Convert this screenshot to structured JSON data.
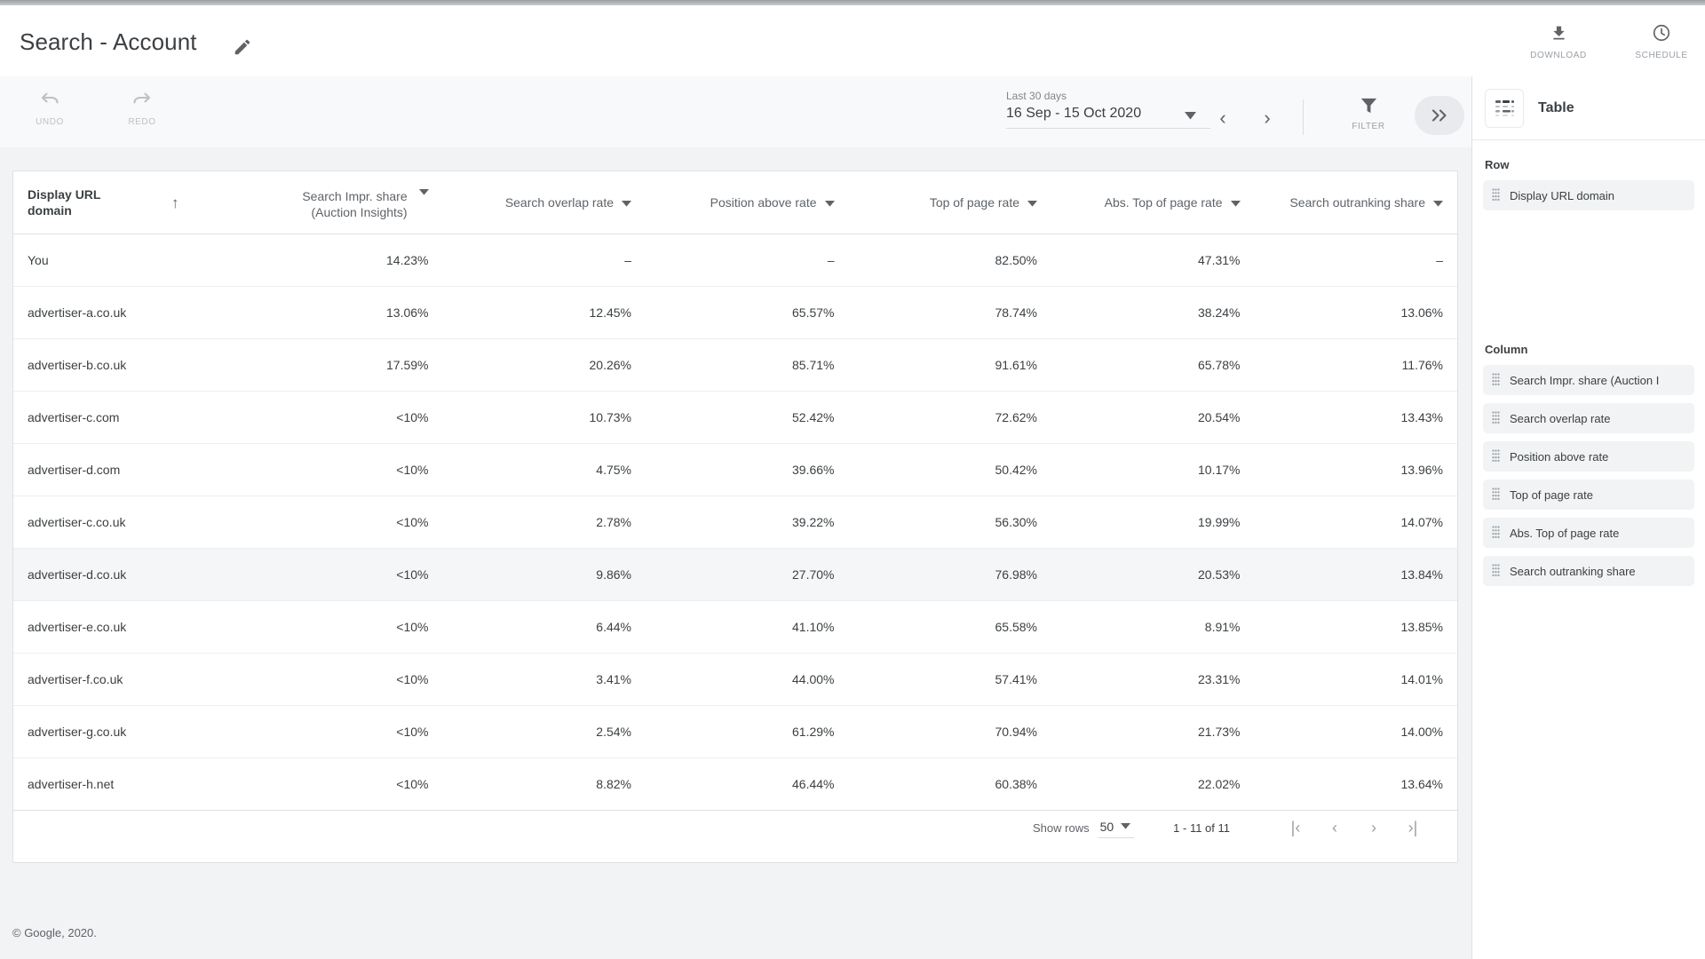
{
  "header": {
    "title": "Search - Account",
    "edit_icon": "pencil-icon",
    "actions": [
      {
        "label": "DOWNLOAD",
        "icon": "download-icon"
      },
      {
        "label": "SCHEDULE",
        "icon": "schedule-clock-icon"
      }
    ]
  },
  "toolbar": {
    "undo_label": "UNDO",
    "redo_label": "REDO",
    "date_preset": "Last 30 days",
    "date_range": "16 Sep - 15 Oct 2020",
    "prev_arrow": "‹",
    "next_arrow": "›",
    "filter_label": "FILTER",
    "expand_label": "»"
  },
  "table": {
    "columns": [
      {
        "label": "Display URL domain",
        "label_line1": "Display URL",
        "label_line2": "domain",
        "sorted": true,
        "sort_dir": "asc",
        "menu": false
      },
      {
        "label": "Search Impr. share (Auction Insights)",
        "label_line1": "Search Impr. share",
        "label_line2": "(Auction Insights)",
        "menu": true
      },
      {
        "label": "Search overlap rate",
        "menu": true
      },
      {
        "label": "Position above rate",
        "menu": true
      },
      {
        "label": "Top of page rate",
        "menu": true
      },
      {
        "label": "Abs. Top of page rate",
        "menu": true
      },
      {
        "label": "Search outranking share",
        "menu": true
      }
    ],
    "rows": [
      {
        "highlight": false,
        "cells": [
          "You",
          "14.23%",
          "–",
          "–",
          "82.50%",
          "47.31%",
          "–"
        ]
      },
      {
        "highlight": false,
        "cells": [
          "advertiser-a.co.uk",
          "13.06%",
          "12.45%",
          "65.57%",
          "78.74%",
          "38.24%",
          "13.06%"
        ]
      },
      {
        "highlight": false,
        "cells": [
          "advertiser-b.co.uk",
          "17.59%",
          "20.26%",
          "85.71%",
          "91.61%",
          "65.78%",
          "11.76%"
        ]
      },
      {
        "highlight": false,
        "cells": [
          "advertiser-c.com",
          "<10%",
          "10.73%",
          "52.42%",
          "72.62%",
          "20.54%",
          "13.43%"
        ]
      },
      {
        "highlight": false,
        "cells": [
          "advertiser-d.com",
          "<10%",
          "4.75%",
          "39.66%",
          "50.42%",
          "10.17%",
          "13.96%"
        ]
      },
      {
        "highlight": false,
        "cells": [
          "advertiser-c.co.uk",
          "<10%",
          "2.78%",
          "39.22%",
          "56.30%",
          "19.99%",
          "14.07%"
        ]
      },
      {
        "highlight": true,
        "cells": [
          "advertiser-d.co.uk",
          "<10%",
          "9.86%",
          "27.70%",
          "76.98%",
          "20.53%",
          "13.84%"
        ]
      },
      {
        "highlight": false,
        "cells": [
          "advertiser-e.co.uk",
          "<10%",
          "6.44%",
          "41.10%",
          "65.58%",
          "8.91%",
          "13.85%"
        ]
      },
      {
        "highlight": false,
        "cells": [
          "advertiser-f.co.uk",
          "<10%",
          "3.41%",
          "44.00%",
          "57.41%",
          "23.31%",
          "14.01%"
        ]
      },
      {
        "highlight": false,
        "cells": [
          "advertiser-g.co.uk",
          "<10%",
          "2.54%",
          "61.29%",
          "70.94%",
          "21.73%",
          "14.00%"
        ]
      },
      {
        "highlight": false,
        "cells": [
          "advertiser-h.net",
          "<10%",
          "8.82%",
          "46.44%",
          "60.38%",
          "22.02%",
          "13.64%"
        ]
      }
    ],
    "pager": {
      "show_rows_label": "Show rows",
      "rows_per_page": "50",
      "range": "1 - 11 of 11",
      "first": "|‹",
      "prev": "‹",
      "next": "›",
      "last": "›|"
    }
  },
  "right_panel": {
    "title": "Table",
    "icon": "table-icon",
    "row_section_label": "Row",
    "row_fields": [
      "Display URL domain"
    ],
    "column_section_label": "Column",
    "column_fields": [
      "Search Impr. share (Auction I",
      "Search overlap rate",
      "Position above rate",
      "Top of page rate",
      "Abs. Top of page rate",
      "Search outranking share"
    ]
  },
  "footer": {
    "copyright": "© Google, 2020."
  },
  "colors": {
    "accent": "#1a73e8",
    "text": "#3c4043",
    "muted": "#5f6368",
    "bg": "#f1f3f4",
    "highlight": "#f5f6f7"
  }
}
